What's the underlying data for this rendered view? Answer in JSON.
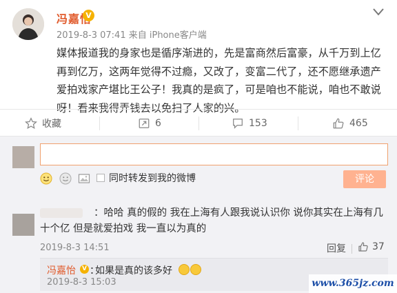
{
  "post": {
    "author": "冯嘉怡",
    "verified_badge": "V",
    "meta": "2019-8-3 07:41 来自 iPhone客户端",
    "body": "媒体报道我的身家也是循序渐进的，先是富商然后富豪，从千万到上亿再到亿万，这两年觉得不过瘾，又改了，变富二代了，还不愿继承遗产爱拍戏家产堪比王公子！我真的是疯了，可是咱也不能说，咱也不敢说呀！看来我得弄钱去以免扫了人家的兴。"
  },
  "actions": {
    "favorite_label": "收藏",
    "repost_count": "6",
    "comment_count": "153",
    "like_count": "465"
  },
  "composer": {
    "input_value": "",
    "repost_checkbox_label": "同时转发到我的微博",
    "submit_label": "评论"
  },
  "comment": {
    "text": "：哈哈 真的假的 我在上海有人跟我说认识你 说你其实在上海有几十个亿 但是就爱拍戏 我一直以为真的",
    "time": "2019-8-3 14:51",
    "reply_label": "回复",
    "like_count": "37",
    "reply": {
      "user": "冯嘉怡",
      "badge": "V",
      "colon": "：",
      "text": "如果是真的该多好",
      "time": "2019-8-3 15:03"
    }
  },
  "watermark": "www.365jz.com",
  "icons": [
    "chevron-down-icon",
    "star-icon",
    "repost-icon",
    "comment-icon",
    "thumbs-up-icon",
    "emoji-icon",
    "picture-icon"
  ],
  "colors": {
    "author": "#e0592a",
    "badge": "#f5b200",
    "submit": "#ffb290",
    "input_border": "#f0a06d"
  }
}
